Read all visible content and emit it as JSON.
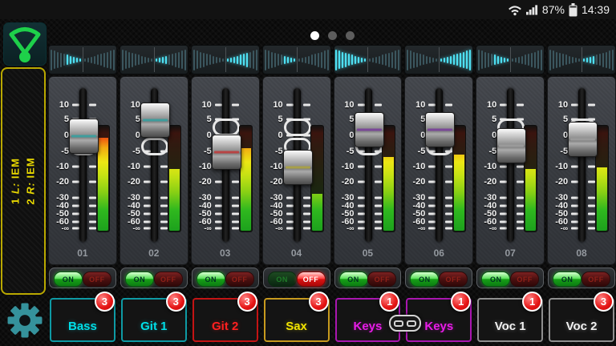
{
  "status_bar": {
    "battery_level": "87%",
    "time": "14:39",
    "icons": [
      "wifi",
      "signal",
      "battery"
    ]
  },
  "pager": {
    "dot_count": 3,
    "active_dot": 0
  },
  "output_panel": {
    "lines": [
      {
        "num": "1",
        "side": "L:",
        "bus": "IEM"
      },
      {
        "num": "2",
        "side": "R:",
        "bus": "IEM"
      }
    ]
  },
  "fader_scale": [
    "10",
    "5",
    "0",
    "-5",
    "-10",
    "-20",
    "-30",
    "-40",
    "-50",
    "-60",
    "-∞"
  ],
  "onoff": {
    "on_label": "ON",
    "off_label": "OFF"
  },
  "stereo_link": {
    "between": [
      "05",
      "06"
    ]
  },
  "colors": {
    "pan_lit": "#4fe0f2",
    "badge": "#e51414",
    "sidebar_accent": "#e8d800",
    "gear": "#35929c",
    "logo_green": "#1ed04a"
  },
  "channels": [
    {
      "number": "01",
      "name": "Bass",
      "badge": "3",
      "on": true,
      "fader_db": 0,
      "meter_percent": 88,
      "pan_side": "left",
      "pan_amount": 5,
      "text_color": "#00dfe8",
      "border_color": "#0e9aa4",
      "knob_line_color": "#3f9d9d"
    },
    {
      "number": "02",
      "name": "Git 1",
      "badge": "3",
      "on": true,
      "fader_db": 5,
      "meter_percent": 58,
      "pan_side": "right",
      "pan_amount": 4,
      "text_color": "#00dfe8",
      "border_color": "#0e9aa4",
      "knob_line_color": "#3f9d9d"
    },
    {
      "number": "03",
      "name": "Git 2",
      "badge": "3",
      "on": true,
      "fader_db": -5,
      "meter_percent": 78,
      "pan_side": "right",
      "pan_amount": 7,
      "text_color": "#ff2020",
      "border_color": "#c41414",
      "knob_line_color": "#b84444"
    },
    {
      "number": "04",
      "name": "Sax",
      "badge": "3",
      "on": false,
      "fader_db": -10,
      "meter_percent": 35,
      "pan_side": "left",
      "pan_amount": 4,
      "text_color": "#f2e400",
      "border_color": "#c79a1e",
      "knob_line_color": "#a8a048"
    },
    {
      "number": "05",
      "name": "Keys",
      "badge": "1",
      "on": true,
      "fader_db": 2,
      "meter_percent": 70,
      "pan_side": "left",
      "pan_amount": 10,
      "text_color": "#e81ce8",
      "border_color": "#a916b0",
      "knob_line_color": "#7a4898"
    },
    {
      "number": "06",
      "name": "Keys",
      "badge": "1",
      "on": true,
      "fader_db": 2,
      "meter_percent": 72,
      "pan_side": "right",
      "pan_amount": 10,
      "text_color": "#e81ce8",
      "border_color": "#a916b0",
      "knob_line_color": "#7a4898"
    },
    {
      "number": "07",
      "name": "Voc 1",
      "badge": "1",
      "on": true,
      "fader_db": -3,
      "meter_percent": 58,
      "pan_side": "left",
      "pan_amount": 5,
      "text_color": "#f2f2f2",
      "border_color": "#8f8f8f",
      "knob_line_color": "#9a9a9a"
    },
    {
      "number": "08",
      "name": "Voc 2",
      "badge": "3",
      "on": true,
      "fader_db": -1,
      "meter_percent": 60,
      "pan_side": "right",
      "pan_amount": 4,
      "text_color": "#f2f2f2",
      "border_color": "#8f8f8f",
      "knob_line_color": "#9a9a9a"
    }
  ]
}
